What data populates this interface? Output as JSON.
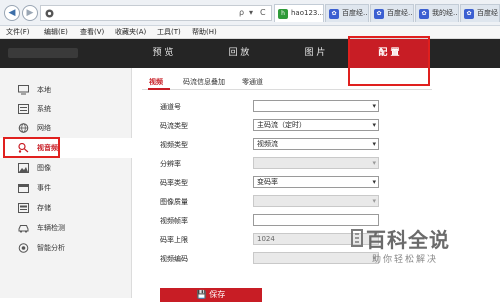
{
  "browser": {
    "url_controls": [
      "ρ",
      "▾",
      "C"
    ],
    "tabs": [
      {
        "label": "hao123...",
        "icon": "hao123-icon",
        "active": true
      },
      {
        "label": "百度经...",
        "icon": "paw-icon",
        "active": false
      },
      {
        "label": "百度经...",
        "icon": "paw-icon",
        "active": false
      },
      {
        "label": "我的经...",
        "icon": "paw-icon",
        "active": false
      },
      {
        "label": "百度经",
        "icon": "paw-icon",
        "active": false
      }
    ],
    "menu": [
      "文件(F)",
      "编辑(E)",
      "查看(V)",
      "收藏夹(A)",
      "工具(T)",
      "帮助(H)"
    ]
  },
  "header": {
    "tabs": [
      {
        "label": "预 览",
        "active": false
      },
      {
        "label": "回 放",
        "active": false
      },
      {
        "label": "图 片",
        "active": false
      },
      {
        "label": "配 置",
        "active": true
      }
    ]
  },
  "sidebar": {
    "items": [
      {
        "label": "本地",
        "icon": "monitor-icon",
        "active": false
      },
      {
        "label": "系统",
        "icon": "system-icon",
        "active": false
      },
      {
        "label": "网络",
        "icon": "globe-icon",
        "active": false
      },
      {
        "label": "视音频",
        "icon": "video-audio-icon",
        "active": true
      },
      {
        "label": "图像",
        "icon": "image-icon",
        "active": false
      },
      {
        "label": "事件",
        "icon": "calendar-icon",
        "active": false
      },
      {
        "label": "存储",
        "icon": "storage-icon",
        "active": false
      },
      {
        "label": "车辆检测",
        "icon": "car-icon",
        "active": false
      },
      {
        "label": "智能分析",
        "icon": "smart-analysis-icon",
        "active": false
      }
    ]
  },
  "subtabs": [
    {
      "label": "视频",
      "active": true
    },
    {
      "label": "码流信息叠加",
      "active": false
    },
    {
      "label": "零通道",
      "active": false
    }
  ],
  "form": {
    "fields": [
      {
        "label": "通道号",
        "value": "",
        "disabled": false,
        "select": true
      },
      {
        "label": "码流类型",
        "value": "主码流（定时）",
        "disabled": false,
        "select": true
      },
      {
        "label": "视频类型",
        "value": "视频流",
        "disabled": false,
        "select": true
      },
      {
        "label": "分辨率",
        "value": "",
        "disabled": true,
        "select": true
      },
      {
        "label": "码率类型",
        "value": "变码率",
        "disabled": false,
        "select": true
      },
      {
        "label": "图像质量",
        "value": "",
        "disabled": true,
        "select": true
      },
      {
        "label": "视频帧率",
        "value": "",
        "disabled": false,
        "select": false
      },
      {
        "label": "码率上限",
        "value": "1024",
        "disabled": true,
        "select": false
      },
      {
        "label": "视频编码",
        "value": "",
        "disabled": true,
        "select": true
      }
    ],
    "save_label": "保存"
  },
  "watermark": {
    "title": "百科全说",
    "subtitle": "助你轻松解决"
  },
  "colors": {
    "accent": "#c81d25",
    "header_bg": "#252525",
    "highlight_box": "#e0201e"
  }
}
